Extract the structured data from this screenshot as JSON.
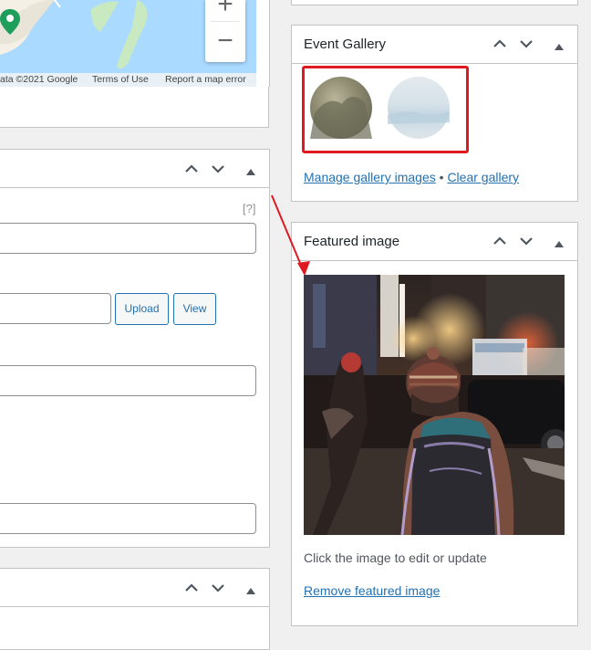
{
  "map": {
    "zoom_in_label": "+",
    "zoom_out_label": "−",
    "attribution": "ata ©2021 Google",
    "terms": "Terms of Use",
    "report": "Report a map error"
  },
  "left_box": {
    "help_label": "[?]",
    "upload_label": "Upload",
    "view_label": "View"
  },
  "event_gallery": {
    "title": "Event Gallery",
    "manage_link": "Manage gallery images",
    "separator": "•",
    "clear_link": "Clear gallery"
  },
  "featured_image": {
    "title": "Featured image",
    "hint": "Click the image to edit or update",
    "remove_link": "Remove featured image"
  },
  "colors": {
    "accent": "#2271b1",
    "highlight": "#e0181f",
    "map_water": "#aadaff",
    "map_land": "#c9e9c0"
  }
}
